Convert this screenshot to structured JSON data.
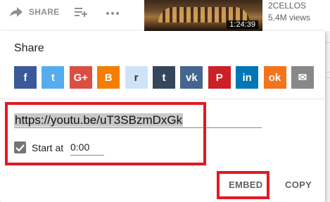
{
  "background": {
    "actions": [
      {
        "icon": "share-arrow-icon",
        "label": "SHARE"
      },
      {
        "icon": "add-to-playlist-icon",
        "label": ""
      },
      {
        "icon": "more-horizontal-icon",
        "label": ""
      }
    ],
    "related_video": {
      "duration": "1:24:39",
      "channel": "2CELLOS",
      "views": "5.4M views"
    }
  },
  "share_dialog": {
    "title": "Share",
    "social_icons": [
      {
        "name": "facebook-icon",
        "glyph": "f",
        "color": "#3b5998"
      },
      {
        "name": "twitter-icon",
        "glyph": "t",
        "color": "#55acee"
      },
      {
        "name": "google-plus-icon",
        "glyph": "G+",
        "color": "#dc4e41"
      },
      {
        "name": "blogger-icon",
        "glyph": "B",
        "color": "#f57d00"
      },
      {
        "name": "reddit-icon",
        "glyph": "r",
        "color": "#cee3f8"
      },
      {
        "name": "tumblr-icon",
        "glyph": "t",
        "color": "#35465c"
      },
      {
        "name": "vk-icon",
        "glyph": "vk",
        "color": "#45668e"
      },
      {
        "name": "pinterest-icon",
        "glyph": "P",
        "color": "#cb2027"
      },
      {
        "name": "linkedin-icon",
        "glyph": "in",
        "color": "#0077b5"
      },
      {
        "name": "odnoklassniki-icon",
        "glyph": "ok",
        "color": "#f4731c"
      },
      {
        "name": "email-icon",
        "glyph": "✉",
        "color": "#888888"
      }
    ],
    "url": "https://youtu.be/uT3SBzmDxGk",
    "start_at_label": "Start at",
    "start_at_value": "0:00",
    "start_at_checked": true,
    "embed_label": "EMBED",
    "copy_label": "COPY"
  },
  "colors": {
    "highlight_border": "#e21a22"
  }
}
